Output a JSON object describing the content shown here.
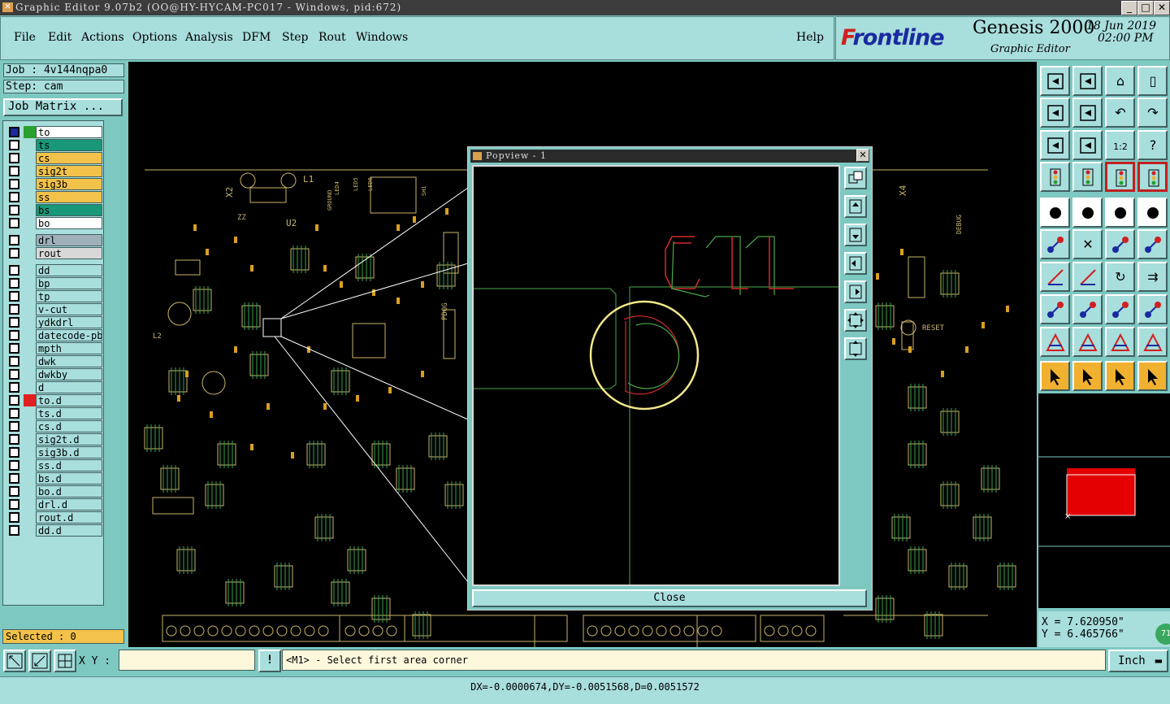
{
  "window": {
    "title": "Graphic Editor 9.07b2 (OO@HY-HYCAM-PC017 - Windows, pid:672)",
    "min": "_",
    "max": "□",
    "close": "✕"
  },
  "menu": {
    "file": "File",
    "edit": "Edit",
    "actions": "Actions",
    "options": "Options",
    "analysis": "Analysis",
    "dfm": "DFM",
    "step": "Step",
    "rout": "Rout",
    "windows": "Windows",
    "help": "Help"
  },
  "brand": {
    "logo_prefix": "F",
    "logo_rest": "rontline",
    "product": "Genesis 2000",
    "subtitle": "Graphic Editor",
    "date": "18 Jun 2019",
    "time": "02:00 PM"
  },
  "job": {
    "job": "Job : 4v144nqpa0",
    "step": "Step: cam",
    "matrix_button": "Job Matrix ..."
  },
  "layers": [
    {
      "name": "to",
      "color": "#ffffff",
      "swatch": "#2aa030",
      "active": true
    },
    {
      "name": "ts",
      "color": "#189878",
      "swatch": ""
    },
    {
      "name": "cs",
      "color": "#f2c24a",
      "swatch": ""
    },
    {
      "name": "sig2t",
      "color": "#f2c24a",
      "swatch": ""
    },
    {
      "name": "sig3b",
      "color": "#f2c24a",
      "swatch": ""
    },
    {
      "name": "ss",
      "color": "#f2c24a",
      "swatch": ""
    },
    {
      "name": "bs",
      "color": "#189878",
      "swatch": ""
    },
    {
      "name": "bo",
      "color": "#ffffff",
      "swatch": ""
    },
    {
      "name": "drl",
      "color": "#a0b0b8",
      "swatch": ""
    },
    {
      "name": "rout",
      "color": "#d8d8d8",
      "swatch": ""
    },
    {
      "name": "dd",
      "color": "#a8dedc",
      "swatch": ""
    },
    {
      "name": "bp",
      "color": "#a8dedc",
      "swatch": ""
    },
    {
      "name": "tp",
      "color": "#a8dedc",
      "swatch": ""
    },
    {
      "name": "v-cut",
      "color": "#a8dedc",
      "swatch": ""
    },
    {
      "name": "ydkdrl",
      "color": "#a8dedc",
      "swatch": ""
    },
    {
      "name": "datecode-pbc",
      "color": "#a8dedc",
      "swatch": ""
    },
    {
      "name": "mpth",
      "color": "#a8dedc",
      "swatch": ""
    },
    {
      "name": "dwk",
      "color": "#a8dedc",
      "swatch": ""
    },
    {
      "name": "dwkby",
      "color": "#a8dedc",
      "swatch": ""
    },
    {
      "name": "d",
      "color": "#a8dedc",
      "swatch": ""
    },
    {
      "name": "to.d",
      "color": "#a8dedc",
      "swatch": "#e02020"
    },
    {
      "name": "ts.d",
      "color": "#a8dedc",
      "swatch": ""
    },
    {
      "name": "cs.d",
      "color": "#a8dedc",
      "swatch": ""
    },
    {
      "name": "sig2t.d",
      "color": "#a8dedc",
      "swatch": ""
    },
    {
      "name": "sig3b.d",
      "color": "#a8dedc",
      "swatch": ""
    },
    {
      "name": "ss.d",
      "color": "#a8dedc",
      "swatch": ""
    },
    {
      "name": "bs.d",
      "color": "#a8dedc",
      "swatch": ""
    },
    {
      "name": "bo.d",
      "color": "#a8dedc",
      "swatch": ""
    },
    {
      "name": "drl.d",
      "color": "#a8dedc",
      "swatch": ""
    },
    {
      "name": "rout.d",
      "color": "#a8dedc",
      "swatch": ""
    },
    {
      "name": "dd.d",
      "color": "#a8dedc",
      "swatch": ""
    }
  ],
  "selected": "Selected : 0",
  "board_labels": {
    "x2": "X2",
    "l1": "L1",
    "u2": "U2",
    "x4": "X4",
    "debug": "DEBUG",
    "reset": "RESET",
    "l2": "L2",
    "zz": "ZZ",
    "pdog": "PDOG",
    "ground": "GROUND",
    "led4": "LED4",
    "led5": "LED5",
    "led6": "LED6",
    "sh1": "SH1"
  },
  "popview": {
    "title": "Popview - 1",
    "close": "Close",
    "ref_text": "C11"
  },
  "coords": {
    "x": "X = 7.620950\"",
    "y": "Y = 6.465766\""
  },
  "bottom": {
    "xy_label": "X Y :",
    "xy_value": "",
    "bang": "!",
    "message": "<M1> - Select first area corner",
    "units": "Inch"
  },
  "status": "DX=-0.0000674,DY=-0.0051568,D=0.0051572",
  "badge": "71"
}
